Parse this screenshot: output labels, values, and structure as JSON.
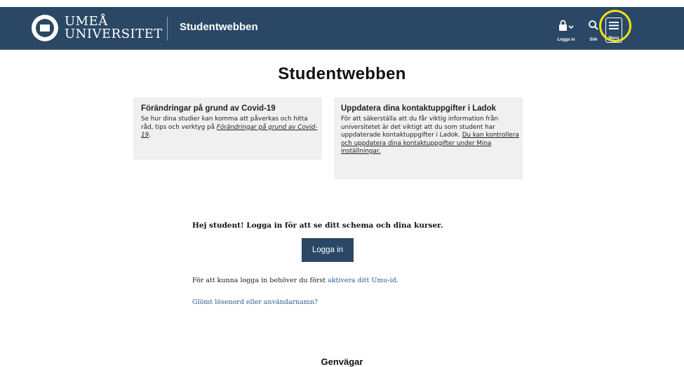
{
  "header": {
    "logo_line1": "UMEÅ",
    "logo_line2": "UNIVERSITET",
    "site_title": "Studentwebben",
    "nav": {
      "login_label": "Logga in",
      "search_label": "Sök",
      "menu_label": "Meny"
    }
  },
  "main": {
    "title": "Studentwebben",
    "cards": [
      {
        "title": "Förändringar på grund av Covid-19",
        "body": "Se hur dina studier kan komma att påverkas och hitta råd, tips och verktyg på ",
        "link": "Förändringar på grund av Covid-19",
        "after": "."
      },
      {
        "title": "Uppdatera dina kontaktuppgifter i Ladok",
        "body": "För att säkerställa att du får viktig information från universitetet är det viktigt att du som student har uppdaterade kontaktuppgifter i Ladok. ",
        "link": "Du kan kontrollera och uppdatera dina kontaktuppgifter under Mina inställningar."
      }
    ],
    "greeting": "Hej student! Logga in för att se ditt schema och dina kurser.",
    "login_button": "Logga in",
    "activate_text": "För att kunna logga in behöver du först ",
    "activate_link": "aktivera ditt Umu-id",
    "activate_after": ".",
    "forgot_link": "Glömt lösenord eller användarnamn?",
    "shortcuts_heading": "Genvägar"
  },
  "colors": {
    "header_bg": "#2a4866",
    "highlight": "#f1e311",
    "link": "#2a5c8f",
    "card_bg": "#f0f0f0"
  }
}
